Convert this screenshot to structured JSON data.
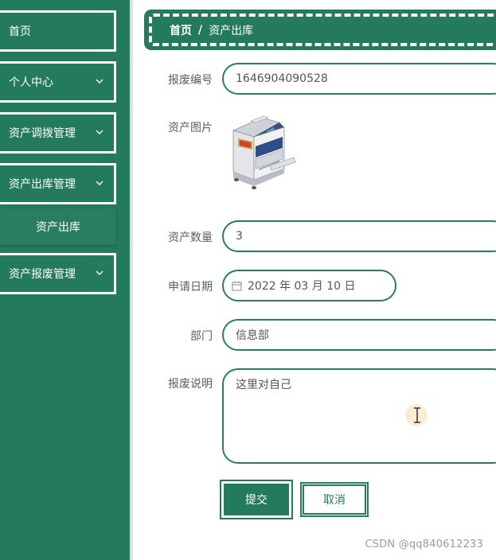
{
  "sidebar": {
    "items": [
      {
        "label": "首页",
        "has_chevron": false
      },
      {
        "label": "个人中心",
        "has_chevron": true
      },
      {
        "label": "资产调拨管理",
        "has_chevron": true
      },
      {
        "label": "资产出库管理",
        "has_chevron": true
      },
      {
        "label": "资产报废管理",
        "has_chevron": true
      }
    ],
    "submenu": {
      "label": "资产出库"
    }
  },
  "breadcrumb": {
    "home": "首页",
    "separator": "/",
    "current": "资产出库"
  },
  "form": {
    "scrap_no": {
      "label": "报废编号",
      "value": "1646904090528"
    },
    "asset_image": {
      "label": "资产图片",
      "icon": "printer-copier-image"
    },
    "quantity": {
      "label": "资产数量",
      "value": "3"
    },
    "apply_date": {
      "label": "申请日期",
      "value": "2022 年 03 月 10 日",
      "icon": "calendar-icon"
    },
    "department": {
      "label": "部门",
      "value": "信息部"
    },
    "description": {
      "label": "报废说明",
      "value": "这里对自己"
    }
  },
  "buttons": {
    "submit": "提交",
    "cancel": "取消"
  },
  "watermark": "CSDN @qq840612233",
  "colors": {
    "primary": "#247a5c",
    "border": "#2a7e60",
    "background": "#ffffff"
  }
}
